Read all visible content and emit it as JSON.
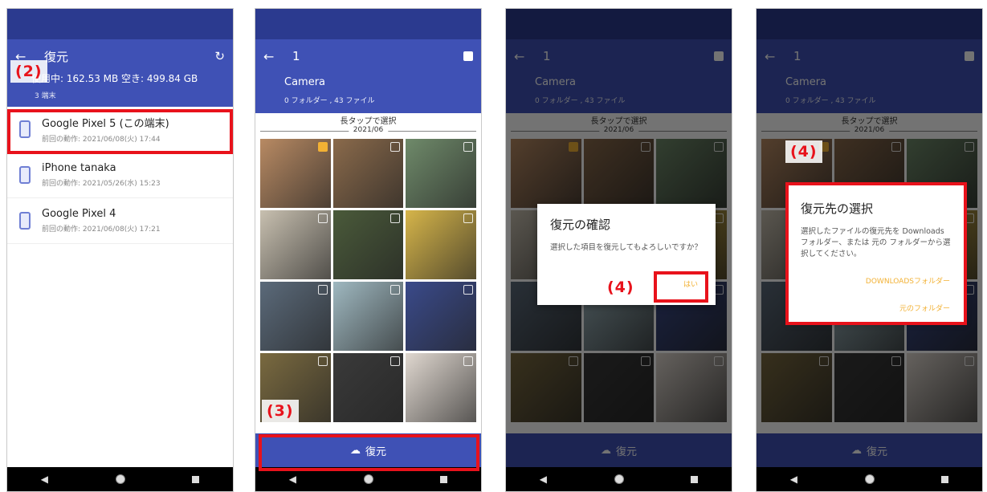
{
  "screen1": {
    "title": "復元",
    "back_icon": "←",
    "refresh_icon": "↻",
    "storage_text": "使用中: 162.53 MB 空き: 499.84 GB",
    "device_count": "3 端末",
    "devices": [
      {
        "name": "Google Pixel 5 (この端末)",
        "last": "前回の動作: 2021/06/08(火) 17:44"
      },
      {
        "name": "iPhone tanaka",
        "last": "前回の動作: 2021/05/26(水) 15:23"
      },
      {
        "name": "Google Pixel 4",
        "last": "前回の動作: 2021/06/08(火) 17:21"
      }
    ],
    "step_label": "(2)"
  },
  "gallery": {
    "selected_count": "1",
    "folder_name": "Camera",
    "folder_info": "0 フォルダー , 43 ファイル",
    "hint": "長タップで選択",
    "date_header": "2021/06",
    "restore_label": "復元",
    "restore_icon": "☁"
  },
  "screen2": {
    "step_label": "(3)"
  },
  "screen3": {
    "dialog_title": "復元の確認",
    "dialog_body": "選択した項目を復元してもよろしいですか？",
    "yes_label": "はい",
    "step_label": "(4)"
  },
  "screen4": {
    "dialog_title": "復元先の選択",
    "dialog_body": "選択したファイルの復元先を Downloads フォルダー、または 元の フォルダーから選択してください。",
    "downloads_label": "DOWNLOADSフォルダー",
    "original_label": "元のフォルダー",
    "step_label": "(4)"
  },
  "navbar": {
    "back": "◀"
  },
  "colors": {
    "primary": "#3f51b5",
    "statusbar": "#2b3a8f",
    "accent": "#f2b134",
    "highlight": "#e8121b"
  },
  "thumb_colors": [
    "#b88a63",
    "#8a6a4b",
    "#6f8a6a",
    "#c8c0b0",
    "#4a5a3a",
    "#d6b54a",
    "#5b6a7a",
    "#9fb8c0",
    "#3a4a8a",
    "#7a6a40",
    "#3a3a3a",
    "#e0d8d0"
  ]
}
